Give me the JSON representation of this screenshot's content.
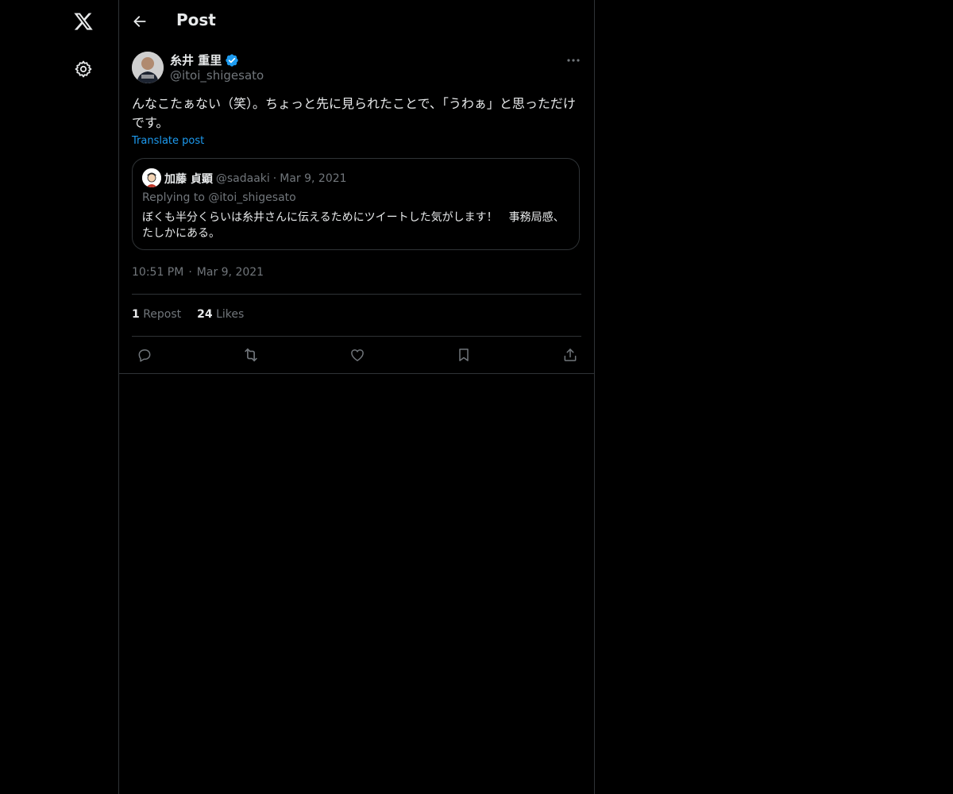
{
  "nav": {
    "logo_icon": "x-logo-icon",
    "settings_icon": "gear-icon"
  },
  "header": {
    "title": "Post",
    "back_icon": "arrow-left-icon"
  },
  "post": {
    "author_name": "糸井 重里",
    "author_handle": "@itoi_shigesato",
    "verified": true,
    "text": "んなこたぁない（笑）。ちょっと先に見られたことで、「うわぁ」と思っただけです。",
    "translate_label": "Translate post",
    "time": "10:51 PM",
    "date": "Mar 9, 2021",
    "separator": "·"
  },
  "quote": {
    "author_name": "加藤 貞顕",
    "author_handle": "@sadaaki",
    "separator": "·",
    "date": "Mar 9, 2021",
    "replying_to": "Replying to @itoi_shigesato",
    "text": "ぼくも半分くらいは糸井さんに伝えるためにツイートした気がします！　事務局感、たしかにある。"
  },
  "stats": {
    "reposts_count": "1",
    "reposts_label": "Repost",
    "likes_count": "24",
    "likes_label": "Likes"
  },
  "actions": [
    "reply-icon",
    "repost-icon",
    "like-icon",
    "bookmark-icon",
    "share-icon"
  ],
  "colors": {
    "background": "#000000",
    "text": "#e7e9ea",
    "secondary_text": "#71767b",
    "accent": "#1d9bf0",
    "border": "#2f3336"
  }
}
